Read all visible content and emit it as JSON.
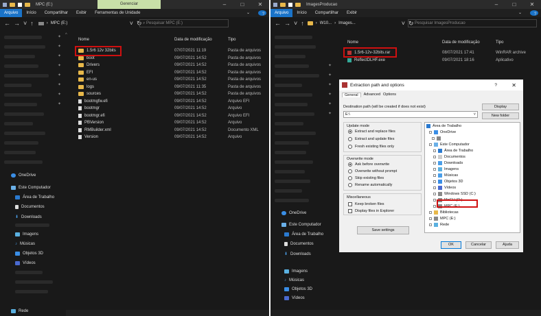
{
  "left_window": {
    "title": "MPC (E:)",
    "manage_tab": "Gerenciar",
    "ribbon": [
      "Arquivo",
      "Início",
      "Compartilhar",
      "Exibir",
      "Ferramentas de Unidade"
    ],
    "address": "MPC (E:)",
    "search_placeholder": "Pesquisar MPC (E:)",
    "columns": {
      "name": "Nome",
      "date": "Data de modificação",
      "type": "Tipo"
    },
    "files": [
      {
        "name": "1.5r6 12v 32bits",
        "date": "07/07/2021 11:19",
        "type": "Pasta de arquivos",
        "kind": "folder"
      },
      {
        "name": "boot",
        "date": "09/07/2021 14:52",
        "type": "Pasta de arquivos",
        "kind": "folder"
      },
      {
        "name": "Drivers",
        "date": "09/07/2021 14:52",
        "type": "Pasta de arquivos",
        "kind": "folder"
      },
      {
        "name": "EFI",
        "date": "09/07/2021 14:52",
        "type": "Pasta de arquivos",
        "kind": "folder"
      },
      {
        "name": "en-us",
        "date": "09/07/2021 14:52",
        "type": "Pasta de arquivos",
        "kind": "folder"
      },
      {
        "name": "logs",
        "date": "09/07/2021 11:35",
        "type": "Pasta de arquivos",
        "kind": "folder"
      },
      {
        "name": "sources",
        "date": "09/07/2021 14:52",
        "type": "Pasta de arquivos",
        "kind": "folder"
      },
      {
        "name": "bootmgfw.efi",
        "date": "09/07/2021 14:52",
        "type": "Arquivo EFI",
        "kind": "file"
      },
      {
        "name": "bootmgr",
        "date": "09/07/2021 14:52",
        "type": "Arquivo",
        "kind": "file"
      },
      {
        "name": "bootmgr.efi",
        "date": "09/07/2021 14:52",
        "type": "Arquivo EFI",
        "kind": "file"
      },
      {
        "name": "PBVersion",
        "date": "09/07/2021 14:52",
        "type": "Arquivo",
        "kind": "file"
      },
      {
        "name": "RMBuilder.xml",
        "date": "09/07/2021 14:52",
        "type": "Documento XML",
        "kind": "file"
      },
      {
        "name": "Version",
        "date": "09/07/2021 14:52",
        "type": "Arquivo",
        "kind": "file"
      }
    ],
    "sidebar": [
      "OneDrive",
      "Este Computador",
      "Área de Trabalho",
      "Documentos",
      "Downloads",
      "Imagens",
      "Músicas",
      "Objetos 3D",
      "Vídeos",
      "Rede"
    ]
  },
  "right_window": {
    "title": "ImagesProducao",
    "ribbon": [
      "Arquivo",
      "Início",
      "Compartilhar",
      "Exibir"
    ],
    "address_parts": [
      "W10...",
      "Images..."
    ],
    "search_placeholder": "Pesquisar ImagesProducao",
    "columns": {
      "name": "Nome",
      "date": "Data de modificação",
      "type": "Tipo"
    },
    "files": [
      {
        "name": "1.5r6-12v-32bits.rar",
        "date": "08/07/2021 17:41",
        "type": "WinRAR archive",
        "kind": "rar"
      },
      {
        "name": "ReflectDLHF.exe",
        "date": "09/07/2021 18:16",
        "type": "Aplicativo",
        "kind": "exe"
      }
    ],
    "sidebar": [
      "OneDrive",
      "Este Computador",
      "Área de Trabalho",
      "Documentos",
      "Downloads",
      "Imagens",
      "Músicas",
      "Objetos 3D",
      "Vídeos"
    ]
  },
  "dialog": {
    "title": "Extraction path and options",
    "help": "?",
    "close": "✕",
    "tabs": [
      "General",
      "Advanced",
      "Options"
    ],
    "dest_label": "Destination path (will be created if does not exist)",
    "dest_value": "E:\\",
    "display_btn": "Display",
    "new_folder_btn": "New folder",
    "update_mode": {
      "label": "Update mode",
      "options": [
        "Extract and replace files",
        "Extract and update files",
        "Fresh existing files only"
      ],
      "selected": 0
    },
    "overwrite_mode": {
      "label": "Overwrite mode",
      "options": [
        "Ask before overwrite",
        "Overwrite without prompt",
        "Skip existing files",
        "Rename automatically"
      ],
      "selected": 0
    },
    "misc": {
      "label": "Miscellaneous",
      "options": [
        "Keep broken files",
        "Display files in Explorer"
      ]
    },
    "save_btn": "Save settings",
    "ok": "OK",
    "cancel": "Cancelar",
    "help_btn": "Ajuda",
    "tree": [
      "Área de Trabalho",
      "OneDrive",
      "",
      "Este Computador",
      "Área de Trabalho",
      "Documentos",
      "Downloads",
      "Imagens",
      "Músicas",
      "Objetos 3D",
      "Vídeos",
      "Windows SSD (C:)",
      "MoGU (D:)",
      "MPC (E:)",
      "Bibliotecas",
      "MPC (E:)",
      "Rede"
    ]
  },
  "colors": {
    "highlight": "#d01010",
    "accent": "#1a73c8",
    "folder": "#e8b84a"
  }
}
